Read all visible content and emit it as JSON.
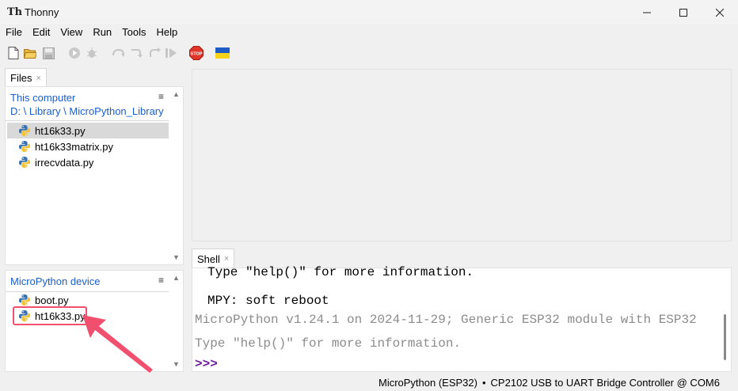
{
  "window": {
    "logo_text": "Th",
    "title": "Thonny"
  },
  "menubar": [
    "File",
    "Edit",
    "View",
    "Run",
    "Tools",
    "Help"
  ],
  "toolbar": {
    "icons": [
      "new-file-icon",
      "open-file-icon",
      "save-icon",
      "run-icon",
      "debug-icon",
      "step-over-icon",
      "step-into-icon",
      "step-out-icon",
      "resume-icon",
      "stop-icon",
      "ukraine-flag-icon"
    ],
    "stop_label": "STOP",
    "colors": {
      "stop": "#e0352b",
      "flag_blue": "#1f5bc4",
      "flag_yellow": "#f6d21a"
    }
  },
  "files_tab": {
    "label": "Files",
    "close": "×"
  },
  "this_computer": {
    "title": "This computer",
    "path": "D: \\ Library \\ MicroPython_Library",
    "menu_glyph": "≡",
    "files": [
      {
        "name": "ht16k33.py",
        "selected": true
      },
      {
        "name": "ht16k33matrix.py",
        "selected": false
      },
      {
        "name": "irrecvdata.py",
        "selected": false
      }
    ]
  },
  "device": {
    "title": "MicroPython device",
    "menu_glyph": "≡",
    "files": [
      {
        "name": "boot.py"
      },
      {
        "name": "ht16k33.py"
      }
    ]
  },
  "shell_tab": {
    "label": "Shell",
    "close": "×"
  },
  "shell": {
    "lines": [
      {
        "text": "Type \"help()\" for more information.",
        "color": "#000000"
      },
      {
        "text": "MPY: soft reboot",
        "color": "#000000"
      },
      {
        "text": "MicroPython v1.24.1 on 2024-11-29; Generic ESP32 module with ESP32",
        "color": "#8c8c8c"
      },
      {
        "text": "Type \"help()\" for more information.",
        "color": "#8c8c8c"
      }
    ],
    "prompt": ">>>",
    "prompt_color": "#6a1b9a"
  },
  "status": {
    "interpreter": "MicroPython (ESP32)",
    "separator": "•",
    "port": "CP2102 USB to UART Bridge Controller @ COM6"
  },
  "annotation": {
    "color": "#f0506e"
  },
  "colors": {
    "link_blue": "#1a5ecc",
    "selection": "#d9d9d9"
  }
}
